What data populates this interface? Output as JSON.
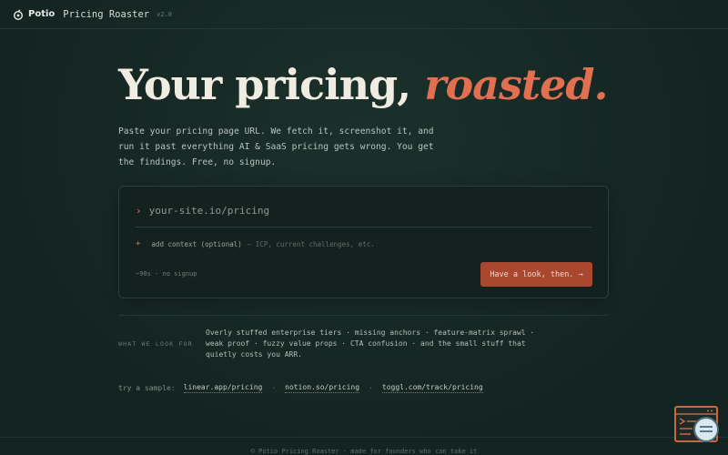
{
  "header": {
    "brand": "Potio",
    "app_name": "Pricing Roaster",
    "version": "v2.0"
  },
  "hero": {
    "title_main": "Your pricing, ",
    "title_accent": "roasted.",
    "subtitle": "Paste your pricing page URL. We fetch it, screenshot it, and run it past everything AI & SaaS pricing gets wrong. You get the findings. Free, no signup."
  },
  "form": {
    "prompt_glyph": "›",
    "url_placeholder": "your-site.io/pricing",
    "context_plus": "+",
    "context_label": "add context (optional)",
    "context_hint": "— ICP, current challenges, etc.",
    "meta": "~90s · no signup",
    "cta_label": "Have a look, then. →"
  },
  "what_we_look_for": {
    "label": "WHAT WE LOOK FOR",
    "text": "Overly stuffed enterprise tiers · missing anchors · feature-matrix sprawl · weak proof · fuzzy value props · CTA confusion · and the small stuff that quietly costs you ARR."
  },
  "samples": {
    "label": "try a sample:",
    "links": [
      "linear.app/pricing",
      "notion.so/pricing",
      "toggl.com/track/pricing"
    ],
    "separator": "·"
  },
  "footer": {
    "text": "© Potio Pricing Roaster · made for founders who can take it"
  },
  "colors": {
    "background": "#142421",
    "accent": "#e0704f",
    "button": "#a9482f",
    "text": "#c9d2cc"
  },
  "icons": {
    "logo": "potio-logo-icon",
    "widget": "code-window-magnifier-icon"
  }
}
